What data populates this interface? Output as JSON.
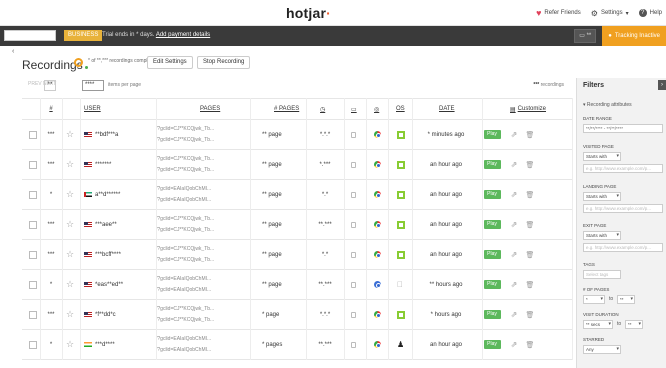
{
  "topbar": {
    "logo": "hotjar",
    "refer_label": "Refer Friends",
    "settings_label": "Settings",
    "help_label": "Help"
  },
  "subbar": {
    "plan_badge": "BUSINESS",
    "trial_text": "Trial ends in * days.",
    "add_payment_label": "Add payment details",
    "device_label": "**",
    "tracking_label": "Tracking Inactive"
  },
  "header": {
    "title": "Recordings",
    "progress_text": "* of **,*** recordings complete",
    "edit_label": "Edit Settings",
    "stop_label": "Stop Recording"
  },
  "controls": {
    "prev_next": "PREV  NEXT",
    "page": "**",
    "per_page": "****",
    "per_page_label": "items per page",
    "record_count": "***",
    "record_suffix": "recordings"
  },
  "table": {
    "headers": {
      "num": "#",
      "user": "USER",
      "pages": "PAGES",
      "num_pages": "# PAGES",
      "date": "DATE",
      "os": "OS",
      "customize": "Customize"
    },
    "play_label": "Play",
    "rows": [
      {
        "num": "***",
        "flag": "us",
        "user": "**bdf***a",
        "page1": "/?gclid=CJ**KCQjwk_Tb...",
        "page2": "/?gclid=CJ**KCQjwk_Tb...",
        "num_pages": "** page",
        "duration": "*.*.*",
        "browser": "chrome",
        "os": "win",
        "date": "* minutes ago"
      },
      {
        "num": "***",
        "flag": "us",
        "user": "*******",
        "page1": "/?gclid=CJ**KCQjwk_Tb...",
        "page2": "/?gclid=CJ**KCQjwk_Tb...",
        "num_pages": "** page",
        "duration": "*.***",
        "browser": "chrome",
        "os": "win",
        "date": "an hour ago"
      },
      {
        "num": "*",
        "flag": "ae",
        "user": "a**d******",
        "page1": "/?gclid=EAIaIQobChMI...",
        "page2": "/?gclid=EAIaIQobChMI...",
        "num_pages": "** page",
        "duration": "*.*",
        "browser": "chrome",
        "os": "win",
        "date": "an hour ago"
      },
      {
        "num": "***",
        "flag": "us",
        "user": "***aee**",
        "page1": "/?gclid=CJ**KCQjwk_Tb...",
        "page2": "/?gclid=CJ**KCQjwk_Tb...",
        "num_pages": "** page",
        "duration": "**.***",
        "browser": "chrome",
        "os": "win",
        "date": "an hour ago"
      },
      {
        "num": "***",
        "flag": "us",
        "user": "***bcff****",
        "page1": "/?gclid=CJ**KCQjwk_Tb...",
        "page2": "/?gclid=CJ**KCQjwk_Tb...",
        "num_pages": "** page",
        "duration": "*.*",
        "browser": "chrome",
        "os": "win",
        "date": "an hour ago"
      },
      {
        "num": "*",
        "flag": "us",
        "user": "*eas**ed**",
        "page1": "/?gclid=EAIaIQobChMI...",
        "page2": "/?gclid=EAIaIQobChMI...",
        "num_pages": "** page",
        "duration": "**.***",
        "browser": "chrome-blue",
        "os": "apple",
        "date": "** hours ago"
      },
      {
        "num": "***",
        "flag": "us",
        "user": "*f**dd*c",
        "page1": "/?gclid=CJ**KCQjwk_Tb...",
        "page2": "/?gclid=CJ**KCQjwk_Tb...",
        "num_pages": "* page",
        "duration": "*.*.*",
        "browser": "chrome",
        "os": "win",
        "date": "* hours ago"
      },
      {
        "num": "*",
        "flag": "in",
        "user": "***d****",
        "page1": "/?gclid=EAIaIQobChMI...",
        "page2": "/?gclid=EAIaIQobChMI...",
        "num_pages": "* pages",
        "duration": "**.***",
        "browser": "chrome",
        "os": "linux",
        "date": "an hour ago"
      }
    ]
  },
  "filters": {
    "title": "Filters",
    "section": "Recording attributes",
    "date_range_label": "DATE RANGE",
    "date_range_value": "**/**/**** - **/**/****",
    "visited_label": "VISITED PAGE",
    "visited_select": "Starts with",
    "visited_placeholder": "e.g. http://www.example.com/p...",
    "landing_label": "LANDING PAGE",
    "landing_select": "Starts with",
    "landing_placeholder": "e.g. http://www.example.com/p...",
    "exit_label": "EXIT PAGE",
    "exit_select": "Starts with",
    "exit_placeholder": "e.g. http://www.example.com/p...",
    "tags_label": "TAGS",
    "tags_placeholder": "Select tags",
    "num_pages_label": "# OF PAGES",
    "num_pages_from": "*",
    "num_pages_to": "**",
    "to_label": "to",
    "duration_label": "VISIT DURATION",
    "duration_from": "** secs",
    "duration_to": "**",
    "starred_label": "STARRED",
    "starred_value": "Any"
  }
}
